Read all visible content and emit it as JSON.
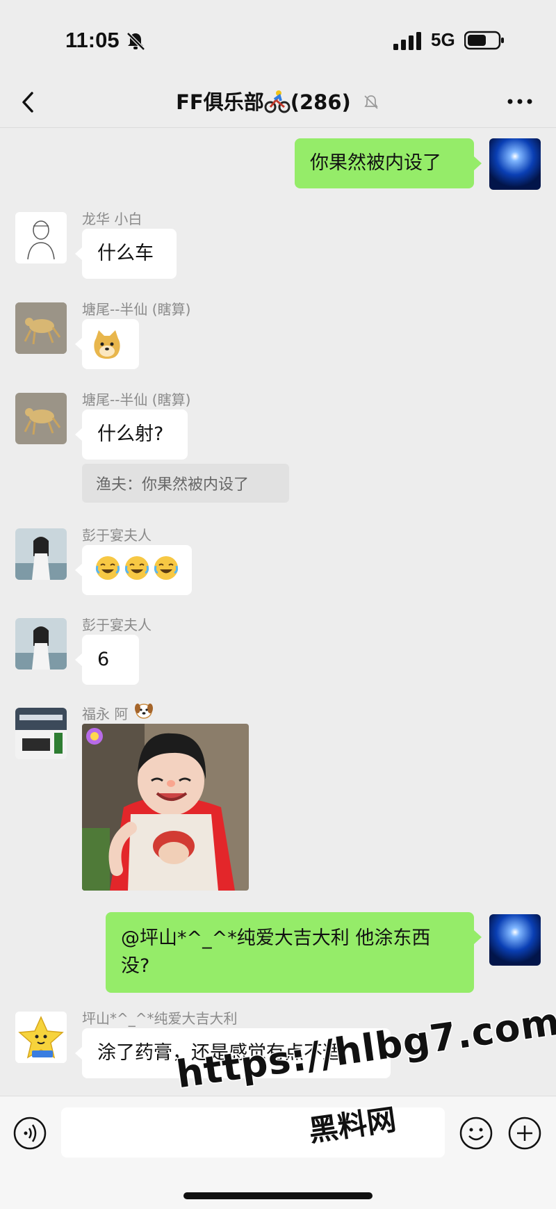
{
  "status_bar": {
    "time": "11:05",
    "network": "5G"
  },
  "nav": {
    "title": "FF俱乐部",
    "member_count": "(286)"
  },
  "messages": {
    "m1": {
      "text": "你果然被内设了"
    },
    "m2": {
      "sender": "龙华  小白",
      "text": "什么车"
    },
    "m3": {
      "sender": "塘尾--半仙 (瞎算)"
    },
    "m4": {
      "sender": "塘尾--半仙 (瞎算)",
      "text": "什么射?",
      "quote": "渔夫：你果然被内设了"
    },
    "m5": {
      "sender": "彭于宴夫人"
    },
    "m6": {
      "sender": "彭于宴夫人",
      "text": "6"
    },
    "m7": {
      "sender": "福永 阿"
    },
    "m8": {
      "text_line1": "@坪山*^_^*纯爱大吉大利 他涂东西",
      "text_line2": "没?"
    },
    "m9": {
      "sender": "坪山*^_^*纯爱大吉大利",
      "text": "涂了药膏，还是感觉有点不适"
    }
  },
  "watermark": {
    "url": "https://hlbg7.com",
    "name": "黑料网"
  },
  "colors": {
    "background": "#ededed",
    "outgoing_bubble": "#95ec69",
    "incoming_bubble": "#ffffff"
  }
}
